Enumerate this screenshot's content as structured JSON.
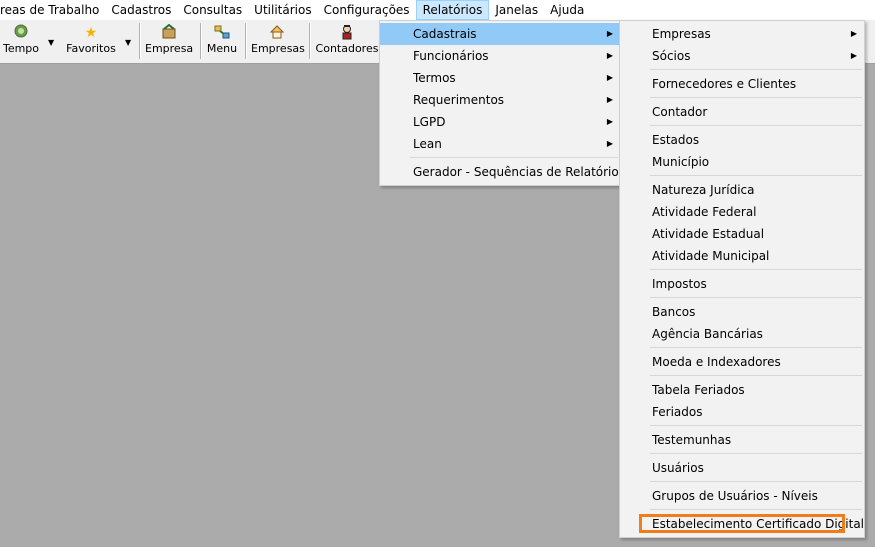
{
  "menubar": {
    "items": [
      "reas de Trabalho",
      "Cadastros",
      "Consultas",
      "Utilitários",
      "Configurações",
      "Relatórios",
      "Janelas",
      "Ajuda"
    ],
    "active": "Relatórios"
  },
  "toolbar": {
    "buttons": [
      {
        "label": "Tempo",
        "icon": "clock-icon"
      },
      {
        "label": "Favoritos",
        "icon": "star-icon"
      },
      {
        "label": "Empresa",
        "icon": "company-icon"
      },
      {
        "label": "Menu",
        "icon": "menu-icon"
      },
      {
        "label": "Empresas",
        "icon": "home-icon"
      },
      {
        "label": "Contadores",
        "icon": "person-icon"
      }
    ]
  },
  "relatorios_menu": {
    "items": [
      "Cadastrais",
      "Funcionários",
      "Termos",
      "Requerimentos",
      "LGPD",
      "Lean",
      "Gerador - Sequências de Relatórios"
    ]
  },
  "cadastrais_menu": {
    "items": [
      "Empresas",
      "Sócios",
      "Fornecedores e Clientes",
      "Contador",
      "Estados",
      "Município",
      "Natureza Jurídica",
      "Atividade Federal",
      "Atividade Estadual",
      "Atividade Municipal",
      "Impostos",
      "Bancos",
      "Agência Bancárias",
      "Moeda e Indexadores",
      "Tabela Feriados",
      "Feriados",
      "Testemunhas",
      "Usuários",
      "Grupos de Usuários - Níveis",
      "Estabelecimento Certificado Digital"
    ]
  },
  "colors": {
    "highlight_box": "#f07d1a",
    "menu_selection": "#91c9f7",
    "workspace": "#ababab"
  }
}
